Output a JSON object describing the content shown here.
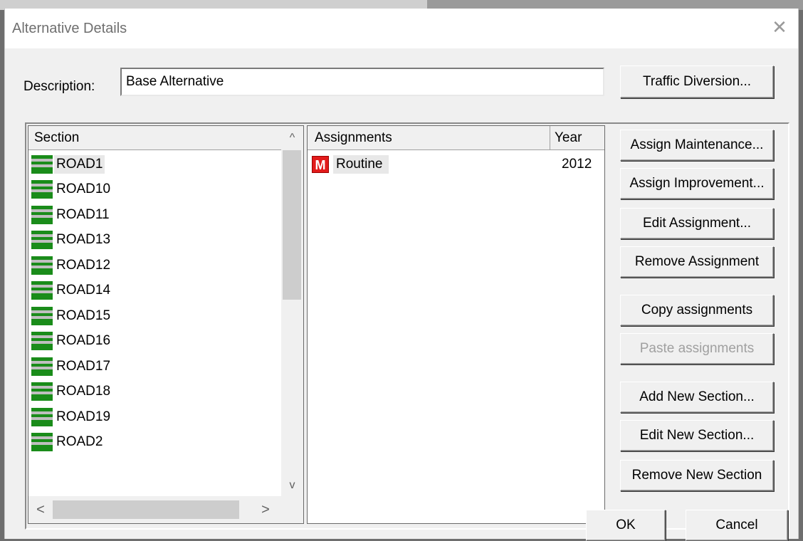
{
  "dialog": {
    "title": "Alternative Details",
    "close_glyph": "✕"
  },
  "description": {
    "label": "Description:",
    "value": "Base Alternative"
  },
  "buttons": {
    "traffic_diversion": "Traffic Diversion...",
    "assign_maintenance": "Assign Maintenance...",
    "assign_improvement": "Assign Improvement...",
    "edit_assignment": "Edit Assignment...",
    "remove_assignment": "Remove Assignment",
    "copy_assignments": "Copy assignments",
    "paste_assignments": "Paste assignments",
    "add_new_section": "Add New Section...",
    "edit_new_section": "Edit New Section...",
    "remove_new_section": "Remove New Section",
    "ok": "OK",
    "cancel": "Cancel"
  },
  "sections": {
    "header": "Section",
    "icon": "road-section-icon",
    "items": [
      {
        "label": "ROAD1",
        "selected": true
      },
      {
        "label": "ROAD10"
      },
      {
        "label": "ROAD11"
      },
      {
        "label": "ROAD13"
      },
      {
        "label": "ROAD12"
      },
      {
        "label": "ROAD14"
      },
      {
        "label": "ROAD15"
      },
      {
        "label": "ROAD16"
      },
      {
        "label": "ROAD17"
      },
      {
        "label": "ROAD18"
      },
      {
        "label": "ROAD19"
      },
      {
        "label": "ROAD2"
      }
    ],
    "scroll_up": "^",
    "scroll_down": "v",
    "scroll_left": "<",
    "scroll_right": ">"
  },
  "assignments": {
    "header_assignments": "Assignments",
    "header_year": "Year",
    "rows": [
      {
        "badge": "M",
        "name": "Routine",
        "year": "2012"
      }
    ]
  },
  "colors": {
    "maintenance_badge": "#e21b1b",
    "road_green": "#1a8c1a"
  }
}
